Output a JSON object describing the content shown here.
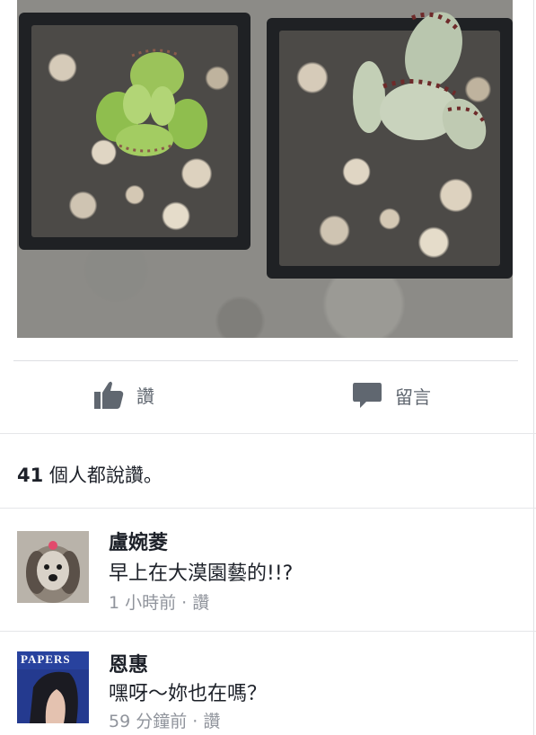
{
  "post": {
    "photo_subject": "two succulents in black square pots on gravel"
  },
  "actions": {
    "like_label": "讚",
    "comment_label": "留言",
    "like_icon": "thumbs-up-icon",
    "comment_icon": "speech-bubble-icon"
  },
  "likes": {
    "count": "41",
    "text": " 個人都說讚。"
  },
  "comments": [
    {
      "name": "盧婉菱",
      "text": "早上在大漠園藝的!!?",
      "time": "1 小時前",
      "sep": " · ",
      "like": "讚"
    },
    {
      "name": "恩惠",
      "text": "嘿呀～妳也在嗎？",
      "time": "59 分鐘前",
      "sep": " · ",
      "like": "讚",
      "avatar_text": "PAPERS"
    }
  ],
  "colors": {
    "action_gray": "#606770",
    "meta_gray": "#90949c",
    "text": "#1d2129"
  }
}
